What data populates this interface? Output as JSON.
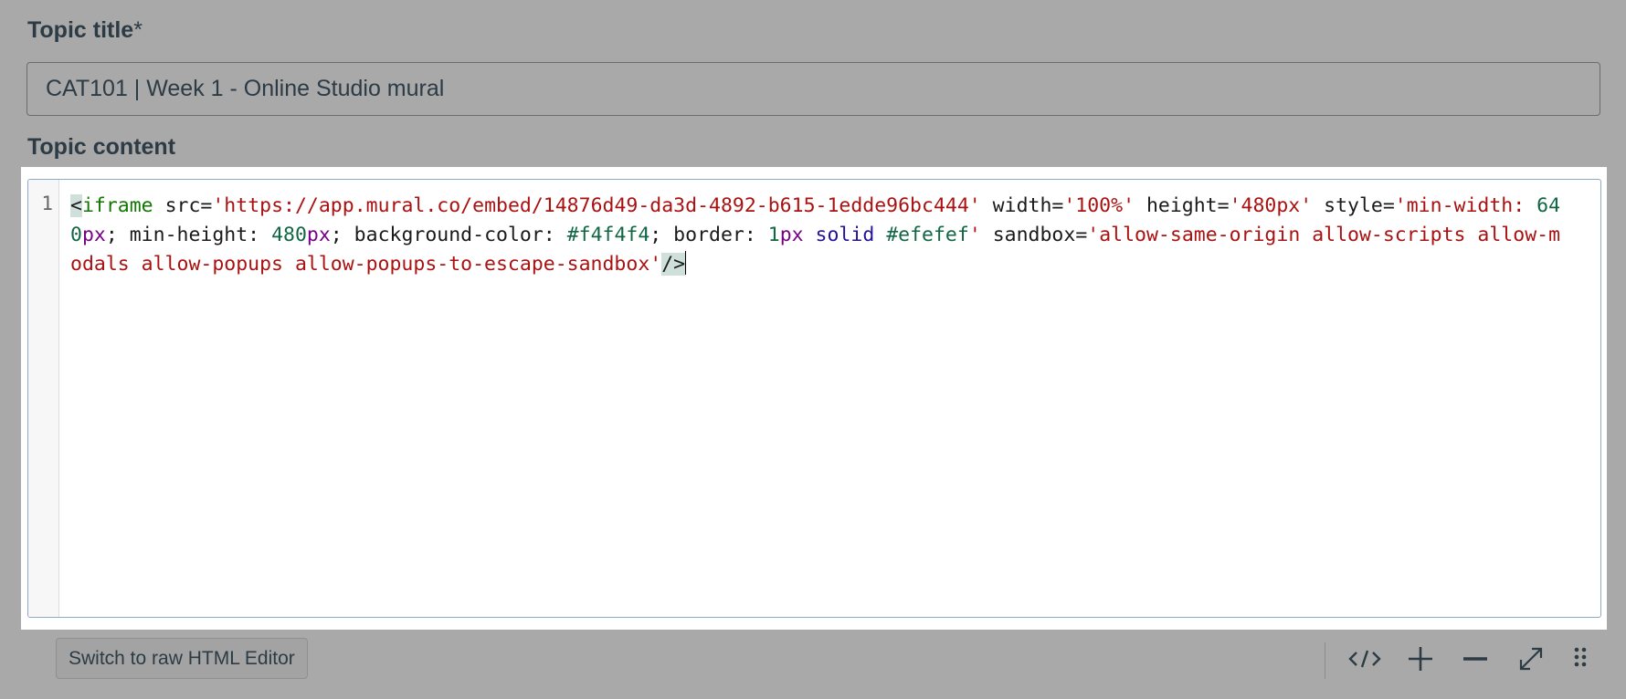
{
  "topic_title": {
    "label": "Topic title",
    "required_marker": "*",
    "value": "CAT101 | Week 1 - Online Studio mural"
  },
  "topic_content": {
    "label": "Topic content",
    "line_number": "1",
    "code_tokens": [
      {
        "t": "<",
        "c": "c-punct c-hl"
      },
      {
        "t": "iframe",
        "c": "c-tag"
      },
      {
        "t": " src=",
        "c": "c-attr"
      },
      {
        "t": "'https://app.mural.co/embed/14876d49-da3d-4892-b615-1edde96bc444'",
        "c": "c-str"
      },
      {
        "t": " width=",
        "c": "c-attr"
      },
      {
        "t": "'100%'",
        "c": "c-str"
      },
      {
        "t": " height=",
        "c": "c-attr"
      },
      {
        "t": "'480px'",
        "c": "c-str"
      },
      {
        "t": " style=",
        "c": "c-attr"
      },
      {
        "t": "'min-width: ",
        "c": "c-str"
      },
      {
        "t": "640",
        "c": "c-num"
      },
      {
        "t": "px",
        "c": "c-unit"
      },
      {
        "t": "; min-height: ",
        "c": "c-attr"
      },
      {
        "t": "480",
        "c": "c-num"
      },
      {
        "t": "px",
        "c": "c-unit"
      },
      {
        "t": "; background-color: ",
        "c": "c-attr"
      },
      {
        "t": "#f4f4f4",
        "c": "c-hex"
      },
      {
        "t": "; border: ",
        "c": "c-attr"
      },
      {
        "t": "1",
        "c": "c-num"
      },
      {
        "t": "px",
        "c": "c-unit"
      },
      {
        "t": " solid ",
        "c": "c-kw"
      },
      {
        "t": "#efefef",
        "c": "c-hex"
      },
      {
        "t": "'",
        "c": "c-str"
      },
      {
        "t": " sandbox=",
        "c": "c-attr"
      },
      {
        "t": "'allow-same-origin allow-scripts allow-modals allow-popups allow-popups-to-escape-sandbox'",
        "c": "c-str"
      },
      {
        "t": "/>",
        "c": "c-punct c-hl"
      }
    ]
  },
  "toolbar": {
    "switch_label": "Switch to raw HTML Editor",
    "icons": [
      "code-icon",
      "plus-icon",
      "minus-icon",
      "expand-icon",
      "drag-handle-icon"
    ]
  },
  "colors": {
    "overlay_background": "#a9a9a9",
    "editor_background": "#ffffff",
    "string": "#aa1111",
    "tag": "#117700",
    "number": "#116644",
    "unit": "#770088",
    "keyword": "#221199"
  }
}
